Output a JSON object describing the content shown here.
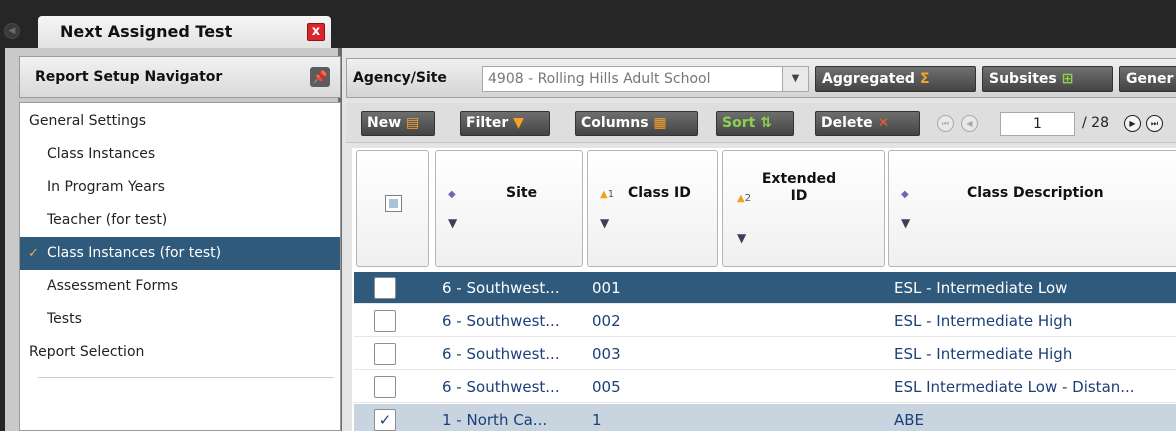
{
  "tab": {
    "title": "Next Assigned Test",
    "close_glyph": "x"
  },
  "navigator": {
    "title": "Report Setup Navigator",
    "items": [
      {
        "label": "General Settings"
      },
      {
        "label": "Class Instances"
      },
      {
        "label": "In Program Years"
      },
      {
        "label": "Teacher (for test)"
      },
      {
        "label": "Class Instances (for test)"
      },
      {
        "label": "Assessment Forms"
      },
      {
        "label": "Tests"
      },
      {
        "label": "Report Selection"
      }
    ]
  },
  "agency": {
    "label": "Agency/Site",
    "selected": "4908 - Rolling Hills Adult School",
    "aggregated_label": "Aggregated",
    "subsites_label": "Subsites",
    "general_label": "Gener"
  },
  "toolbar": {
    "new_label": "New",
    "filter_label": "Filter",
    "columns_label": "Columns",
    "sort_label": "Sort",
    "delete_label": "Delete",
    "page_current": "1",
    "page_total": "/ 28"
  },
  "grid": {
    "columns": {
      "site": "Site",
      "class_id": "Class ID",
      "class_id_sort_order": "1",
      "extended_id": "Extended ID",
      "extended_id_sort_order": "2",
      "class_description": "Class Description"
    },
    "rows": [
      {
        "site": "6 - Southwest...",
        "class_id": "001",
        "extended_id": "",
        "description": "ESL - Intermediate Low",
        "checked": ""
      },
      {
        "site": "6 - Southwest...",
        "class_id": "002",
        "extended_id": "",
        "description": "ESL - Intermediate High",
        "checked": ""
      },
      {
        "site": "6 - Southwest...",
        "class_id": "003",
        "extended_id": "",
        "description": "ESL - Intermediate High",
        "checked": ""
      },
      {
        "site": "6 - Southwest...",
        "class_id": "005",
        "extended_id": "",
        "description": "ESL Intermediate Low - Distan...",
        "checked": ""
      },
      {
        "site": "1 - North Ca...",
        "class_id": "1",
        "extended_id": "",
        "description": "ABE",
        "checked": "✓"
      }
    ]
  },
  "colors": {
    "selected_row": "#2f5a7c",
    "checked_row": "#c8d5e1",
    "link_text": "#1c3f78",
    "close_red": "#d9262c"
  }
}
